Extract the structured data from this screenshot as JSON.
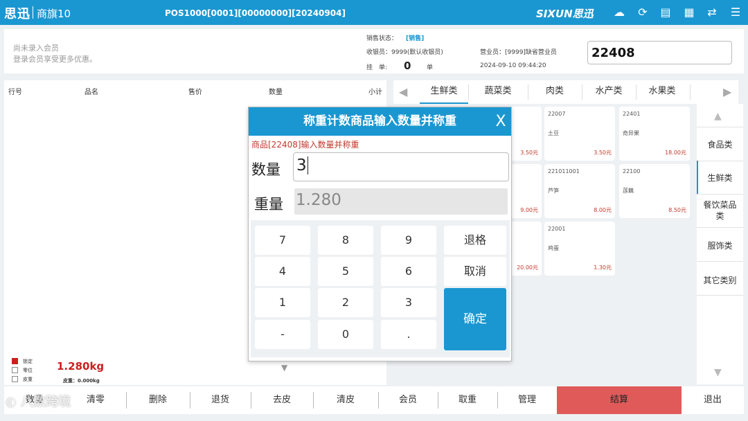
{
  "titlebar": {
    "logo": "思迅",
    "product": "商旗10",
    "pos_info": "POS1000[0001][00000000][20240904]",
    "brand": "SIXUN思迅",
    "icons": [
      "cloud-icon",
      "sync-icon",
      "document-icon",
      "grid-icon",
      "exchange-icon",
      "menu-icon"
    ]
  },
  "header": {
    "member_line1": "尚未录入会员",
    "member_line2": "登录会员享受更多优惠。",
    "sale_status_label": "销售状态：",
    "sale_status_value": "[销售]",
    "cashier": "收银员：9999(默认收银员)",
    "hold_label": "挂　单:",
    "hold_count": "0",
    "hold_unit": "单",
    "salesperson": "营业员：[9999]缺省营业员",
    "datetime": "2024-09-10 09:44:20",
    "code_input": "22408"
  },
  "list": {
    "columns": [
      "行号",
      "品名",
      "售价",
      "数量",
      "小计"
    ]
  },
  "status": {
    "options": [
      "锁定",
      "零位",
      "皮重"
    ],
    "weight": "1.280kg",
    "tare": "皮重：0.000kg"
  },
  "categories": {
    "tabs": [
      "生鲜类",
      "蔬菜类",
      "肉类",
      "水产类",
      "水果类"
    ],
    "active": "生鲜类"
  },
  "goods": [
    {
      "code": "22007",
      "name": "土豆",
      "price": "3.50元"
    },
    {
      "code": "22401",
      "name": "奇异果",
      "price": "18.00元"
    },
    {
      "code": "221011001",
      "name": "芦笋",
      "price": "8.00元"
    },
    {
      "code": "22100",
      "name": "莲藕",
      "price": "8.50元"
    },
    {
      "code": "22001",
      "name": "鸡蛋",
      "price": "1.30元"
    }
  ],
  "goods_partial_prices": [
    "3.50元",
    "9.00元",
    "20.00元"
  ],
  "side_categories": [
    "食品类",
    "生鲜类",
    "餐饮菜品类",
    "服饰类",
    "其它类别"
  ],
  "bottom": {
    "buttons": [
      "数量",
      "清零",
      "删除",
      "退货",
      "去皮",
      "清皮",
      "会员",
      "取重",
      "管理",
      "结算",
      "退出"
    ]
  },
  "watermark": "八数跨境",
  "dialog": {
    "title": "称重计数商品输入数量并称重",
    "close": "X",
    "message": "商品[22408]输入数量并称重",
    "qty_label": "数量",
    "qty_value": "3",
    "weight_label": "重量",
    "weight_value": "1.280",
    "keys": [
      "7",
      "8",
      "9",
      "退格",
      "4",
      "5",
      "6",
      "取消",
      "1",
      "2",
      "3",
      "-",
      "0",
      ".",
      "确定"
    ]
  },
  "colors": {
    "primary": "#1a97d1",
    "checkout": "#e05a5a",
    "weight_red": "#cc1f1f"
  }
}
